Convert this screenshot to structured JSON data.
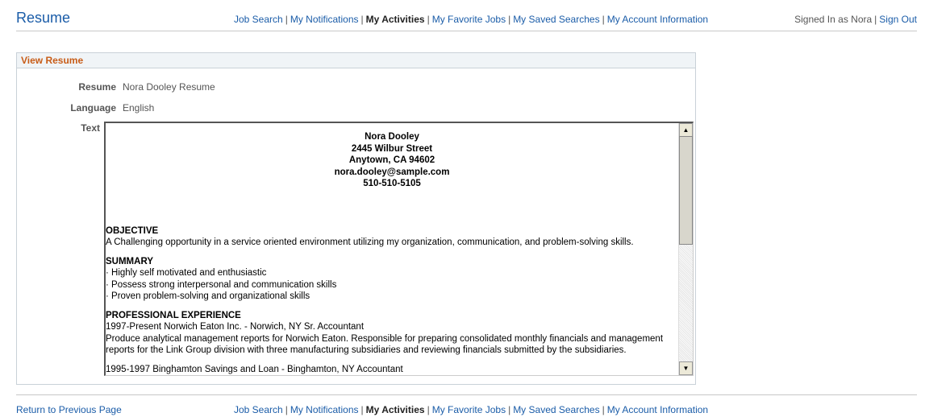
{
  "header": {
    "title": "Resume",
    "nav": [
      {
        "label": "Job Search",
        "active": false
      },
      {
        "label": "My Notifications",
        "active": false
      },
      {
        "label": "My Activities",
        "active": true
      },
      {
        "label": "My Favorite Jobs",
        "active": false
      },
      {
        "label": "My Saved Searches",
        "active": false
      },
      {
        "label": "My Account Information",
        "active": false
      }
    ],
    "signed_in": "Signed In as Nora",
    "sign_out": "Sign Out"
  },
  "panel": {
    "title": "View Resume",
    "resume_label": "Resume",
    "resume_value": "Nora Dooley Resume",
    "language_label": "Language",
    "language_value": "English",
    "text_label": "Text"
  },
  "resume_text": {
    "name": "Nora Dooley",
    "street": "2445 Wilbur Street",
    "city": "Anytown, CA  94602",
    "email": "nora.dooley@sample.com",
    "phone": "510-510-5105",
    "objective_head": "OBJECTIVE",
    "objective": "A Challenging opportunity in a service oriented environment utilizing my organization, communication, and problem-solving skills.",
    "summary_head": "SUMMARY",
    "summary_1": "· Highly self motivated and enthusiastic",
    "summary_2": "· Possess strong interpersonal and communication skills",
    "summary_3": "· Proven problem-solving and organizational skills",
    "experience_head": "PROFESSIONAL EXPERIENCE",
    "exp1_title": "1997-Present  Norwich Eaton Inc. - Norwich, NY  Sr. Accountant",
    "exp1_desc_1": "Produce analytical management reports for Norwich Eaton. Responsible for preparing consolidated monthly financials and management",
    "exp1_desc_2": "reports for the Link Group division with three manufacturing subsidiaries and reviewing financials submitted by the subsidiaries.",
    "exp2_title": "1995-1997  Binghamton Savings and Loan - Binghamton, NY  Accountant"
  },
  "footer": {
    "return": "Return to Previous Page"
  }
}
